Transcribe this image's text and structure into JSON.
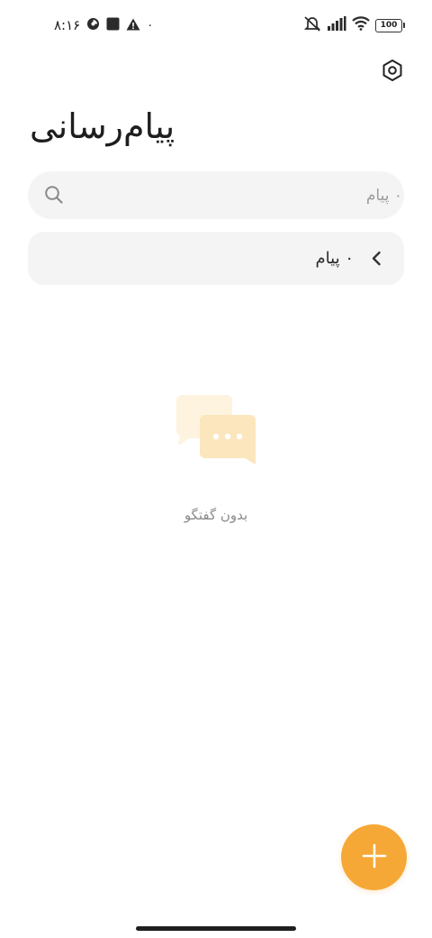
{
  "status_bar": {
    "time": "۸:۱۶",
    "notification_dot": "۰",
    "battery": "100",
    "icons": [
      "screen-record-icon",
      "stop-square-icon",
      "warning-icon",
      "mute-icon",
      "signal-icon",
      "wifi-icon",
      "battery-icon"
    ]
  },
  "header": {
    "title": "پیام‌رسانی",
    "settings_icon": "settings-hexagon-icon"
  },
  "search": {
    "placeholder": "۰ پیام",
    "value": ""
  },
  "message_row": {
    "label": "۰ پیام",
    "icon": "chevron-left-icon"
  },
  "empty_state": {
    "text": "بدون گفتگو",
    "icon": "chat-bubbles-icon"
  },
  "fab": {
    "icon": "plus-icon"
  },
  "colors": {
    "accent": "#f5a836",
    "surface": "#f4f4f4",
    "illustration_light": "#fdf3df",
    "illustration_dark": "#fbe6bd"
  }
}
